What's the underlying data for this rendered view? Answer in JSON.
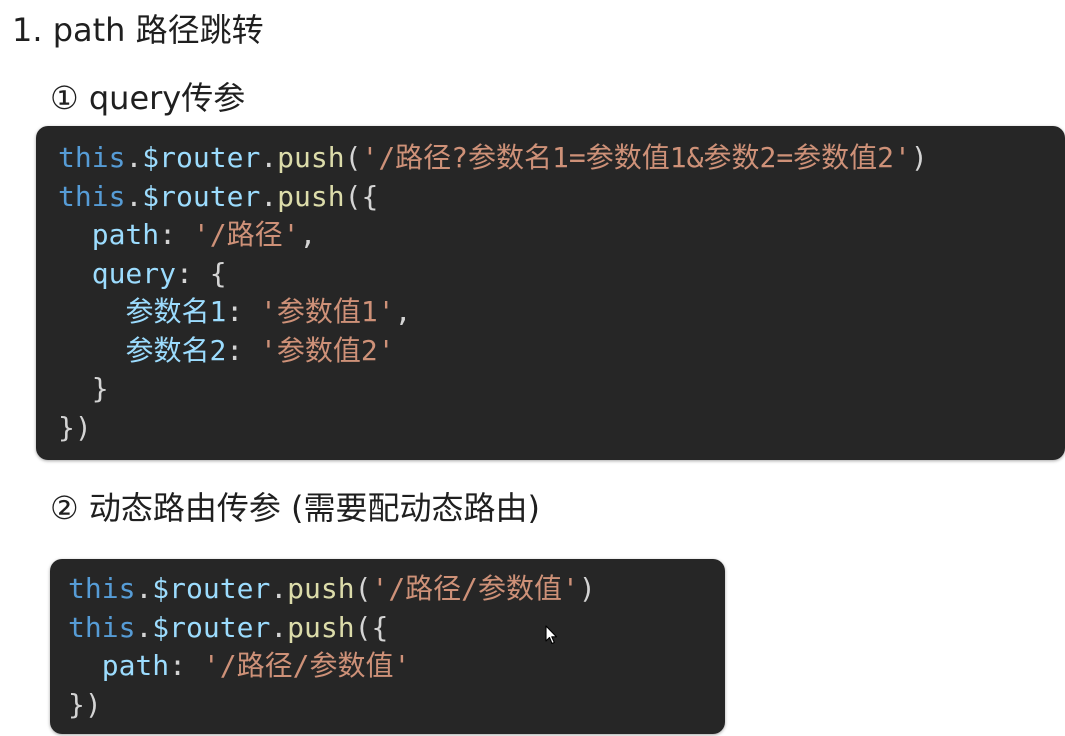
{
  "heading": "1. path 路径跳转",
  "query_section": {
    "label": "① query传参",
    "code": [
      [
        [
          "kw",
          "this"
        ],
        [
          "punc",
          "."
        ],
        [
          "var",
          "$router"
        ],
        [
          "punc",
          "."
        ],
        [
          "fn",
          "push"
        ],
        [
          "punc",
          "("
        ],
        [
          "str",
          "'/路径?参数名1=参数值1&参数2=参数值2'"
        ],
        [
          "punc",
          ")"
        ]
      ],
      [
        [
          "kw",
          "this"
        ],
        [
          "punc",
          "."
        ],
        [
          "var",
          "$router"
        ],
        [
          "punc",
          "."
        ],
        [
          "fn",
          "push"
        ],
        [
          "punc",
          "({"
        ]
      ],
      [
        [
          "punc",
          "  "
        ],
        [
          "var",
          "path"
        ],
        [
          "punc",
          ": "
        ],
        [
          "str",
          "'/路径'"
        ],
        [
          "punc",
          ","
        ]
      ],
      [
        [
          "punc",
          "  "
        ],
        [
          "var",
          "query"
        ],
        [
          "punc",
          ": {"
        ]
      ],
      [
        [
          "punc",
          "    "
        ],
        [
          "var",
          "参数名1"
        ],
        [
          "punc",
          ": "
        ],
        [
          "str",
          "'参数值1'"
        ],
        [
          "punc",
          ","
        ]
      ],
      [
        [
          "punc",
          "    "
        ],
        [
          "var",
          "参数名2"
        ],
        [
          "punc",
          ": "
        ],
        [
          "str",
          "'参数值2'"
        ]
      ],
      [
        [
          "punc",
          "  }"
        ]
      ],
      [
        [
          "punc",
          "})"
        ]
      ]
    ]
  },
  "dynamic_section": {
    "label": "② 动态路由传参 (需要配动态路由)",
    "code": [
      [
        [
          "kw",
          "this"
        ],
        [
          "punc",
          "."
        ],
        [
          "var",
          "$router"
        ],
        [
          "punc",
          "."
        ],
        [
          "fn",
          "push"
        ],
        [
          "punc",
          "("
        ],
        [
          "str",
          "'/路径/参数值'"
        ],
        [
          "punc",
          ")"
        ]
      ],
      [
        [
          "kw",
          "this"
        ],
        [
          "punc",
          "."
        ],
        [
          "var",
          "$router"
        ],
        [
          "punc",
          "."
        ],
        [
          "fn",
          "push"
        ],
        [
          "punc",
          "({"
        ]
      ],
      [
        [
          "punc",
          "  "
        ],
        [
          "var",
          "path"
        ],
        [
          "punc",
          ": "
        ],
        [
          "str",
          "'/路径/参数值'"
        ]
      ],
      [
        [
          "punc",
          "})"
        ]
      ]
    ]
  },
  "colors": {
    "code_background": "#262626",
    "keyword": "#569cd6",
    "variable": "#9cdcfe",
    "function": "#dcdcaa",
    "string": "#ce9178",
    "punctuation": "#d4d4d4"
  },
  "icons": {
    "cursor": "mouse-pointer-icon"
  }
}
